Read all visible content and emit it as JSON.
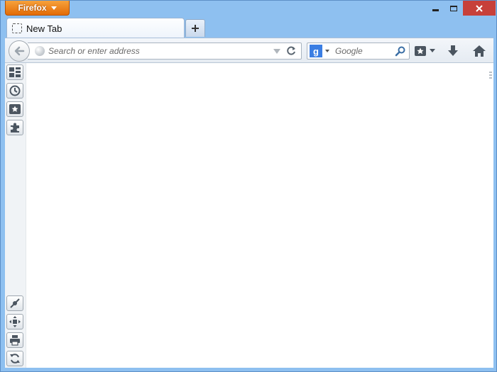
{
  "window": {
    "app_button_label": "Firefox",
    "controls": {
      "minimize": "minimize-icon",
      "maximize": "maximize-icon",
      "close": "close-icon"
    }
  },
  "tabs": [
    {
      "title": "New Tab",
      "icon": "blank-page-icon"
    }
  ],
  "toolbar": {
    "urlbar": {
      "placeholder": "Search or enter address",
      "value": ""
    },
    "search": {
      "engine_letter": "g",
      "placeholder": "Google",
      "value": ""
    }
  },
  "sidebar_top_icons": [
    "newtab-grid-icon",
    "history-clock-icon",
    "bookmarks-star-icon",
    "addons-puzzle-icon"
  ],
  "sidebar_bottom_icons": [
    "connect-icon",
    "fullscreen-icon",
    "print-icon",
    "sync-icon"
  ],
  "colors": {
    "accent": "#e36b06",
    "close": "#c7403a",
    "chrome": "#8ec0f0",
    "search_engine": "#3b7ee3"
  }
}
